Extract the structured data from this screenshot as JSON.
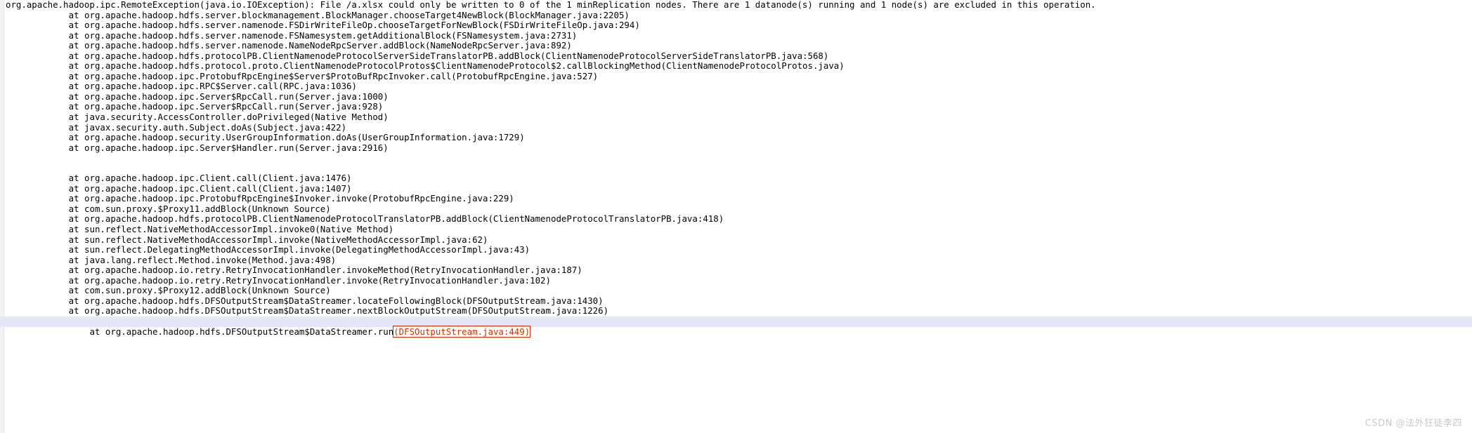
{
  "console": {
    "exception_header": "org.apache.hadoop.ipc.RemoteException(java.io.IOException): File /a.xlsx could only be written to 0 of the 1 minReplication nodes. There are 1 datanode(s) running and 1 node(s) are excluded in this operation.",
    "lines": [
      {
        "text": "        at org.apache.hadoop.hdfs.server.blockmanagement.BlockManager.chooseTarget4NewBlock(BlockManager.java:2205)",
        "highlighted": false,
        "blank": false
      },
      {
        "text": "        at org.apache.hadoop.hdfs.server.namenode.FSDirWriteFileOp.chooseTargetForNewBlock(FSDirWriteFileOp.java:294)",
        "highlighted": false,
        "blank": false
      },
      {
        "text": "        at org.apache.hadoop.hdfs.server.namenode.FSNamesystem.getAdditionalBlock(FSNamesystem.java:2731)",
        "highlighted": false,
        "blank": false
      },
      {
        "text": "        at org.apache.hadoop.hdfs.server.namenode.NameNodeRpcServer.addBlock(NameNodeRpcServer.java:892)",
        "highlighted": false,
        "blank": false
      },
      {
        "text": "        at org.apache.hadoop.hdfs.protocolPB.ClientNamenodeProtocolServerSideTranslatorPB.addBlock(ClientNamenodeProtocolServerSideTranslatorPB.java:568)",
        "highlighted": false,
        "blank": false
      },
      {
        "text": "        at org.apache.hadoop.hdfs.protocol.proto.ClientNamenodeProtocolProtos$ClientNamenodeProtocol$2.callBlockingMethod(ClientNamenodeProtocolProtos.java)",
        "highlighted": false,
        "blank": false
      },
      {
        "text": "        at org.apache.hadoop.ipc.ProtobufRpcEngine$Server$ProtoBufRpcInvoker.call(ProtobufRpcEngine.java:527)",
        "highlighted": false,
        "blank": false
      },
      {
        "text": "        at org.apache.hadoop.ipc.RPC$Server.call(RPC.java:1036)",
        "highlighted": false,
        "blank": false
      },
      {
        "text": "        at org.apache.hadoop.ipc.Server$RpcCall.run(Server.java:1000)",
        "highlighted": false,
        "blank": false
      },
      {
        "text": "        at org.apache.hadoop.ipc.Server$RpcCall.run(Server.java:928)",
        "highlighted": false,
        "blank": false
      },
      {
        "text": "        at java.security.AccessController.doPrivileged(Native Method)",
        "highlighted": false,
        "blank": false
      },
      {
        "text": "        at javax.security.auth.Subject.doAs(Subject.java:422)",
        "highlighted": false,
        "blank": false
      },
      {
        "text": "        at org.apache.hadoop.security.UserGroupInformation.doAs(UserGroupInformation.java:1729)",
        "highlighted": false,
        "blank": false
      },
      {
        "text": "        at org.apache.hadoop.ipc.Server$Handler.run(Server.java:2916)",
        "highlighted": false,
        "blank": false
      },
      {
        "text": "",
        "highlighted": false,
        "blank": true
      },
      {
        "text": "",
        "highlighted": false,
        "blank": true
      },
      {
        "text": "        at org.apache.hadoop.ipc.Client.call(Client.java:1476)",
        "highlighted": false,
        "blank": false
      },
      {
        "text": "        at org.apache.hadoop.ipc.Client.call(Client.java:1407)",
        "highlighted": false,
        "blank": false
      },
      {
        "text": "        at org.apache.hadoop.ipc.ProtobufRpcEngine$Invoker.invoke(ProtobufRpcEngine.java:229)",
        "highlighted": false,
        "blank": false
      },
      {
        "text": "        at com.sun.proxy.$Proxy11.addBlock(Unknown Source)",
        "highlighted": false,
        "blank": false
      },
      {
        "text": "        at org.apache.hadoop.hdfs.protocolPB.ClientNamenodeProtocolTranslatorPB.addBlock(ClientNamenodeProtocolTranslatorPB.java:418)",
        "highlighted": false,
        "blank": false
      },
      {
        "text": "        at sun.reflect.NativeMethodAccessorImpl.invoke0(Native Method)",
        "highlighted": false,
        "blank": false
      },
      {
        "text": "        at sun.reflect.NativeMethodAccessorImpl.invoke(NativeMethodAccessorImpl.java:62)",
        "highlighted": false,
        "blank": false
      },
      {
        "text": "        at sun.reflect.DelegatingMethodAccessorImpl.invoke(DelegatingMethodAccessorImpl.java:43)",
        "highlighted": false,
        "blank": false
      },
      {
        "text": "        at java.lang.reflect.Method.invoke(Method.java:498)",
        "highlighted": false,
        "blank": false
      },
      {
        "text": "        at org.apache.hadoop.io.retry.RetryInvocationHandler.invokeMethod(RetryInvocationHandler.java:187)",
        "highlighted": false,
        "blank": false
      },
      {
        "text": "        at org.apache.hadoop.io.retry.RetryInvocationHandler.invoke(RetryInvocationHandler.java:102)",
        "highlighted": false,
        "blank": false
      },
      {
        "text": "        at com.sun.proxy.$Proxy12.addBlock(Unknown Source)",
        "highlighted": false,
        "blank": false
      },
      {
        "text": "        at org.apache.hadoop.hdfs.DFSOutputStream$DataStreamer.locateFollowingBlock(DFSOutputStream.java:1430)",
        "highlighted": false,
        "blank": false
      },
      {
        "text": "        at org.apache.hadoop.hdfs.DFSOutputStream$DataStreamer.nextBlockOutputStream(DFSOutputStream.java:1226)",
        "highlighted": false,
        "blank": false
      }
    ],
    "final_line": {
      "prefix": "        at org.apache.hadoop.hdfs.DFSOutputStream$DataStreamer.run",
      "link": "(DFSOutputStream.java:449)",
      "highlighted": true,
      "link_color": "#cc3300",
      "highlight_color": "#e6e6fa"
    }
  },
  "watermark": {
    "text": "CSDN @法外狂徒李四"
  }
}
